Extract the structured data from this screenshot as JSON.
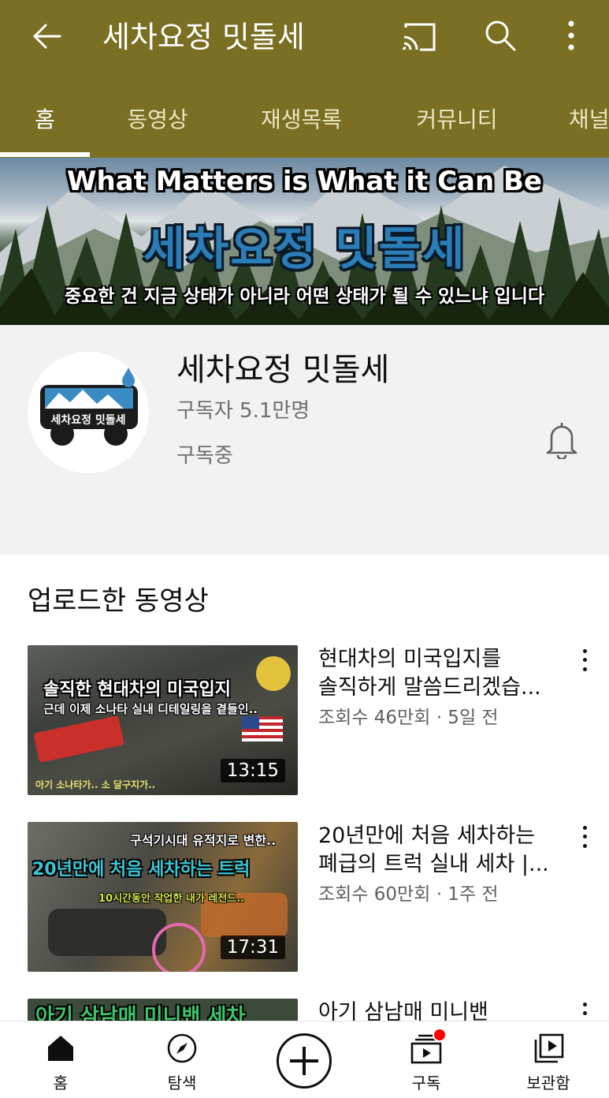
{
  "app_bar": {
    "title": "세차요정 밋돌세",
    "back_icon": "arrow-left-icon",
    "cast_icon": "cast-icon",
    "search_icon": "search-icon",
    "more_icon": "more-vert-icon",
    "bg_color": "#7a6f22"
  },
  "tabs": [
    {
      "label": "홈",
      "active": true
    },
    {
      "label": "동영상"
    },
    {
      "label": "재생목록"
    },
    {
      "label": "커뮤니티"
    },
    {
      "label": "채널"
    }
  ],
  "banner": {
    "line1": "What Matters is What it Can Be",
    "line2": "세차요정 밋돌세",
    "line3": "중요한 건 지금 상태가 아니라 어떤 상태가 될 수 있느냐 입니다"
  },
  "channel": {
    "name": "세차요정 밋돌세",
    "subscribers": "구독자 5.1만명",
    "status": "구독중",
    "avatar_text": "세차요정 밋돌세",
    "bell_icon": "bell-icon"
  },
  "section": {
    "title": "업로드한 동영상"
  },
  "videos": [
    {
      "title_line1": "현대차의 미국입지를",
      "title_line2": "솔직하게 말씀드리겠습...",
      "meta": "조회수 46만회 · 5일 전",
      "duration": "13:15",
      "thumb_text1": "솔직한 현대차의 미국입지",
      "thumb_text2": "근데 이제 소나타 실내 디테일링을 곁들인..",
      "thumb_text3": "아기 소나타가.. 소 달구지가.."
    },
    {
      "title_line1": "20년만에 처음 세차하는",
      "title_line2": "폐급의 트럭 실내 세차 |...",
      "meta": "조회수 60만회 · 1주 전",
      "duration": "17:31",
      "thumb_text1": "구석기시대 유적지로 변한..",
      "thumb_text2": "20년만에 처음 세차하는 트럭",
      "thumb_text3": "10시간동안 작업한 내가 레전드.."
    },
    {
      "title_line1": "아기 삼남매 미니밴",
      "thumb_text1": "아기 삼남매 미니밴 세차"
    }
  ],
  "bottom_nav": [
    {
      "label": "홈",
      "icon": "home-icon"
    },
    {
      "label": "탐색",
      "icon": "explore-compass-icon"
    },
    {
      "label": "",
      "icon": "create-plus-icon"
    },
    {
      "label": "구독",
      "icon": "subscriptions-icon"
    },
    {
      "label": "보관함",
      "icon": "library-icon"
    }
  ]
}
